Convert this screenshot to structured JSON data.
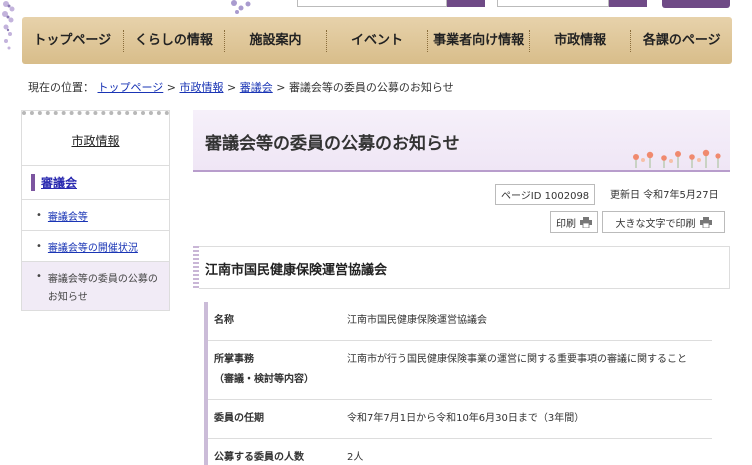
{
  "nav": {
    "items": [
      "トップページ",
      "くらしの情報",
      "施設案内",
      "イベント",
      "事業者向け情報",
      "市政情報",
      "各課のページ"
    ]
  },
  "breadcrumb": {
    "prefix": "現在の位置：",
    "links": [
      "トップページ",
      "市政情報",
      "審議会"
    ],
    "separator": ">",
    "current": "審議会等の委員の公募のお知らせ"
  },
  "sidebar": {
    "heading": "市政情報",
    "category": "審議会",
    "items": [
      "審議会等",
      "審議会等の開催状況"
    ],
    "current_item": "審議会等の委員の公募のお知らせ"
  },
  "main": {
    "title": "審議会等の委員の公募のお知らせ",
    "page_id": "ページID 1002098",
    "updated": "更新日 令和7年5月27日",
    "print_label": "印刷",
    "print_large_label": "大きな文字で印刷",
    "section_title": "江南市国民健康保険運営協議会",
    "rows": [
      {
        "label": "名称",
        "value": "江南市国民健康保険運営協議会"
      },
      {
        "label": "所掌事務\n（審議・検討等内容）",
        "value": "江南市が行う国民健康保険事業の運営に関する重要事項の審議に関すること"
      },
      {
        "label": "委員の任期",
        "value": "令和7年7月1日から令和10年6月30日まで（3年間）"
      },
      {
        "label": "公募する委員の人数",
        "value": "2人"
      }
    ]
  },
  "colors": {
    "accent": "#6f4a86",
    "nav_bg": "#e0c89a",
    "link": "#1a35b5",
    "title_bg": "#f3ecf8"
  }
}
